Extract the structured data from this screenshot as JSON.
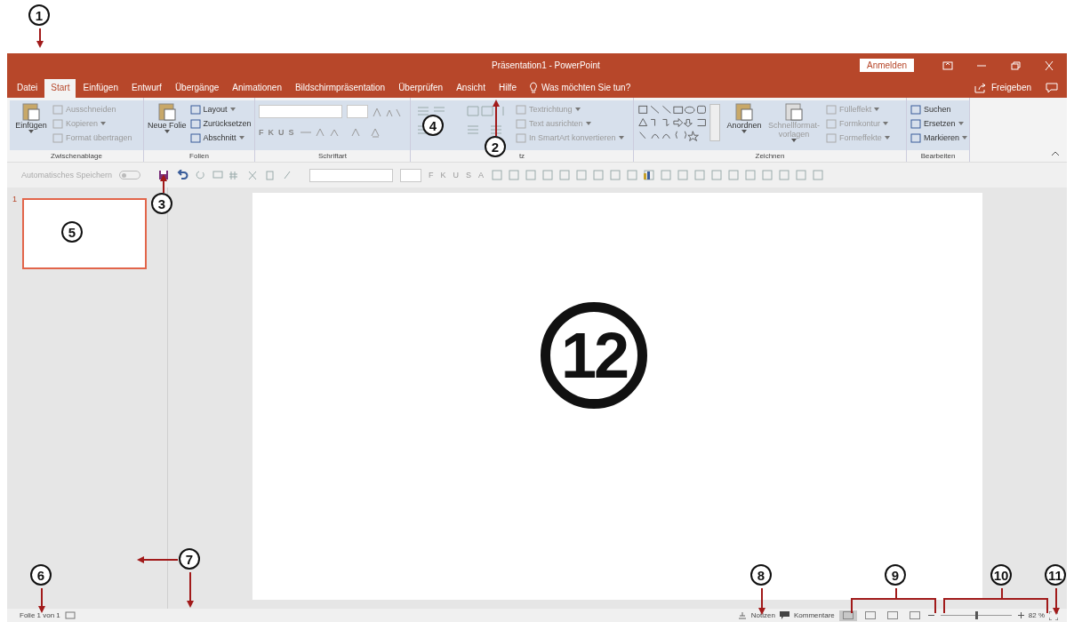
{
  "title_bar": {
    "title": "Präsentation1 - PowerPoint",
    "sign_in": "Anmelden"
  },
  "tabs": [
    {
      "label": "Datei",
      "selected": false
    },
    {
      "label": "Start",
      "selected": true
    },
    {
      "label": "Einfügen",
      "selected": false
    },
    {
      "label": "Entwurf",
      "selected": false
    },
    {
      "label": "Übergänge",
      "selected": false
    },
    {
      "label": "Animationen",
      "selected": false
    },
    {
      "label": "Bildschirmpräsentation",
      "selected": false
    },
    {
      "label": "Überprüfen",
      "selected": false
    },
    {
      "label": "Ansicht",
      "selected": false
    },
    {
      "label": "Hilfe",
      "selected": false
    }
  ],
  "tell_me": "Was möchten Sie tun?",
  "share": "Freigeben",
  "ribbon": {
    "groups": [
      {
        "kind": "buttons",
        "label": "Zwischenablage",
        "big": [
          {
            "label": "Einfügen",
            "disabled": false,
            "dropdown": true
          }
        ],
        "items": [
          {
            "label": "Ausschneiden",
            "disabled": true,
            "dropdown": false
          },
          {
            "label": "Kopieren",
            "disabled": true,
            "dropdown": true
          },
          {
            "label": "Format übertragen",
            "disabled": true,
            "dropdown": false
          }
        ]
      },
      {
        "kind": "buttons",
        "label": "Folien",
        "big": [
          {
            "label": "Neue Folie",
            "disabled": false,
            "dropdown": true
          }
        ],
        "items": [
          {
            "label": "Layout",
            "disabled": false,
            "dropdown": true
          },
          {
            "label": "Zurücksetzen",
            "disabled": false,
            "dropdown": false
          },
          {
            "label": "Abschnitt",
            "disabled": false,
            "dropdown": true
          }
        ]
      },
      {
        "kind": "font",
        "label": "Schriftart",
        "letters": [
          "F",
          "K",
          "U",
          "S"
        ]
      },
      {
        "kind": "paragraph",
        "label": "tz",
        "items": [
          {
            "label": "Textrichtung",
            "disabled": true,
            "dropdown": true
          },
          {
            "label": "Text ausrichten",
            "disabled": true,
            "dropdown": true
          },
          {
            "label": "In SmartArt konvertieren",
            "disabled": true,
            "dropdown": true
          }
        ]
      },
      {
        "kind": "drawing",
        "label": "Zeichnen",
        "big": [
          {
            "label": "Anordnen",
            "disabled": false,
            "dropdown": true
          },
          {
            "label": "Schnellformat-vorlagen",
            "disabled": true,
            "dropdown": true
          }
        ],
        "items": [
          {
            "label": "Fülleffekt",
            "disabled": true,
            "dropdown": true
          },
          {
            "label": "Formkontur",
            "disabled": true,
            "dropdown": true
          },
          {
            "label": "Formeffekte",
            "disabled": true,
            "dropdown": true
          }
        ]
      },
      {
        "kind": "buttons",
        "label": "Bearbeiten",
        "items": [
          {
            "label": "Suchen",
            "disabled": false,
            "dropdown": false
          },
          {
            "label": "Ersetzen",
            "disabled": false,
            "dropdown": true
          },
          {
            "label": "Markieren",
            "disabled": false,
            "dropdown": true
          }
        ]
      }
    ]
  },
  "quick_access": {
    "autosave": {
      "label": "Automatisches Speichern",
      "on": false
    },
    "letters": [
      "F",
      "K",
      "U",
      "S",
      "A"
    ]
  },
  "slides": [
    {
      "number": "1",
      "selected": true
    }
  ],
  "status_bar": {
    "slide_info": "Folie 1 von 1",
    "notes": "Notizen",
    "comments": "Kommentare",
    "views": [
      {
        "selected": true
      },
      {
        "selected": false
      },
      {
        "selected": false
      },
      {
        "selected": false
      }
    ],
    "zoom": {
      "level": 0.5,
      "reading": "82 %"
    }
  },
  "callouts": [
    "1",
    "2",
    "3",
    "4",
    "5",
    "6",
    "7",
    "8",
    "9",
    "10",
    "11",
    "12"
  ]
}
